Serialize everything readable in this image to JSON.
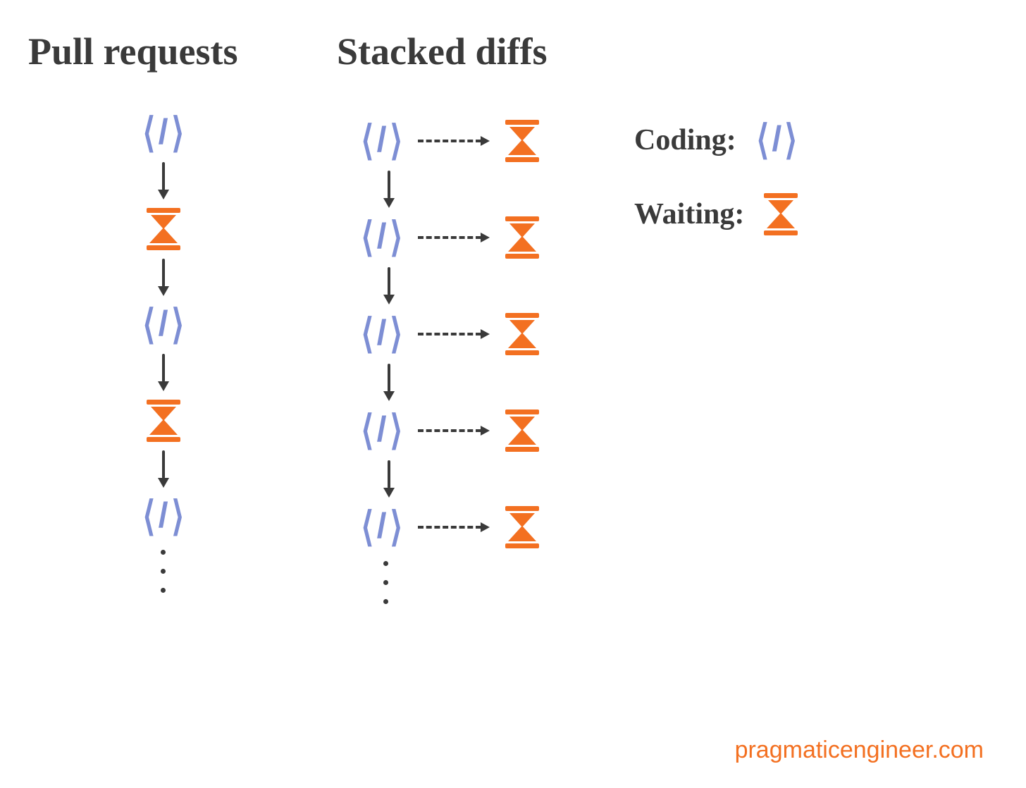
{
  "headings": {
    "pull_requests": "Pull requests",
    "stacked_diffs": "Stacked diffs"
  },
  "legend": {
    "coding_label": "Coding:",
    "waiting_label": "Waiting:",
    "coding_icon": "code-icon",
    "waiting_icon": "hourglass-icon"
  },
  "columns": {
    "pull_requests": {
      "steps": [
        "code",
        "wait",
        "code",
        "wait",
        "code"
      ],
      "continues": true
    },
    "stacked_diffs": {
      "steps": [
        "code+wait",
        "code+wait",
        "code+wait",
        "code+wait",
        "code+wait"
      ],
      "continues": true
    }
  },
  "attribution": "pragmaticengineer.com",
  "colors": {
    "code": "#7d8ed4",
    "wait": "#f37021",
    "ink": "#3a3a3a"
  }
}
